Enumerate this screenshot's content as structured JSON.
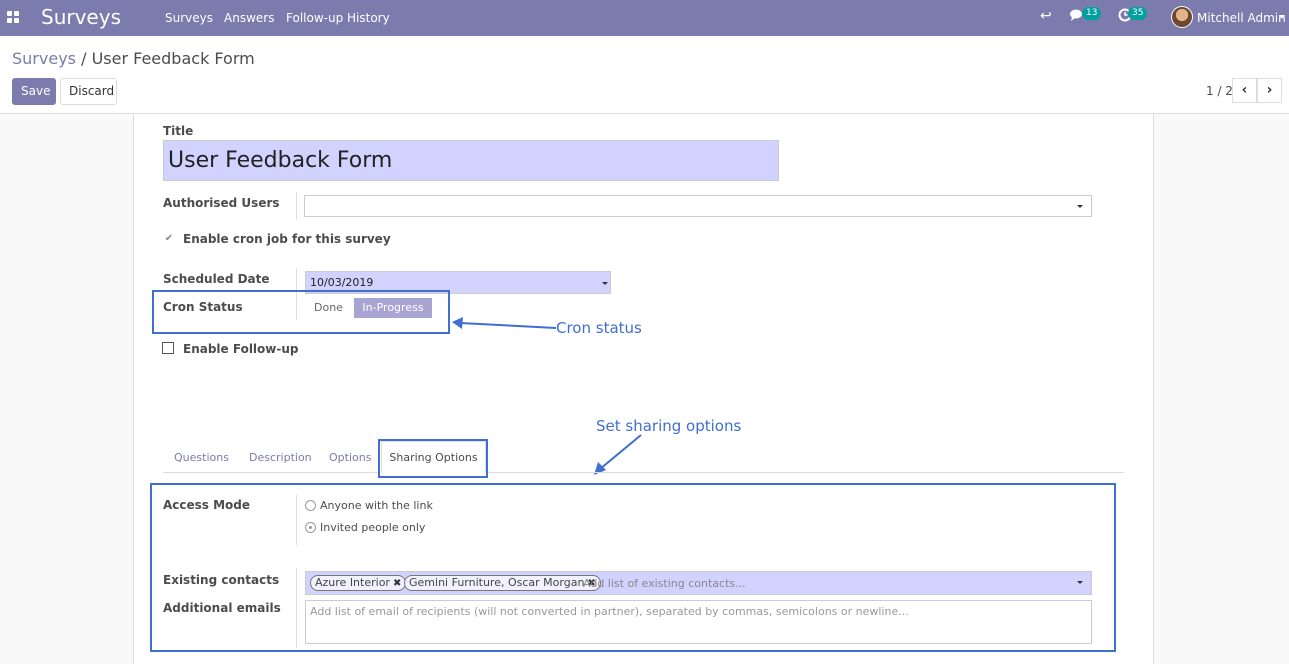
{
  "navbar": {
    "app_name": "Surveys",
    "menus": [
      "Surveys",
      "Answers",
      "Follow-up History"
    ],
    "activity_icon": "reply-icon",
    "messages_count": "13",
    "activities_count": "35",
    "user_name": "Mitchell Admin",
    "color": "#7c7bad"
  },
  "breadcrumb": {
    "parent": "Surveys",
    "separator": "/",
    "current": "User Feedback Form"
  },
  "toolbar": {
    "save_label": "Save",
    "discard_label": "Discard"
  },
  "pager": {
    "value": "1 / 2",
    "prev_icon": "chevron-left-icon",
    "next_icon": "chevron-right-icon"
  },
  "form": {
    "title_label": "Title",
    "title_value": "User Feedback Form",
    "authorised_users_label": "Authorised Users",
    "authorised_users_value": "",
    "cron_checkbox_label": "Enable cron job for this survey",
    "cron_checkbox_checked": true,
    "scheduled_date_label": "Scheduled Date",
    "scheduled_date_value": "10/03/2019",
    "cron_status_label": "Cron Status",
    "cron_status_options": [
      "Done",
      "In-Progress"
    ],
    "cron_status_selected": "In-Progress",
    "followup_label": "Enable Follow-up",
    "followup_checked": false
  },
  "annotations": {
    "cron_status_note": "Cron status",
    "sharing_note": "Set sharing options",
    "color": "#3f6fd1"
  },
  "tabs": [
    "Questions",
    "Description",
    "Options",
    "Sharing Options"
  ],
  "active_tab": "Sharing Options",
  "sharing": {
    "access_mode_label": "Access Mode",
    "access_options": [
      "Anyone with the link",
      "Invited people only"
    ],
    "access_selected": "Invited people only",
    "existing_contacts_label": "Existing contacts",
    "contacts": [
      "Azure Interior",
      "Gemini Furniture, Oscar Morgan"
    ],
    "contacts_placeholder": "Add list of existing contacts...",
    "additional_emails_label": "Additional emails",
    "emails_placeholder": "Add list of email of recipients (will not converted in partner), separated by commas, semicolons or newline..."
  }
}
